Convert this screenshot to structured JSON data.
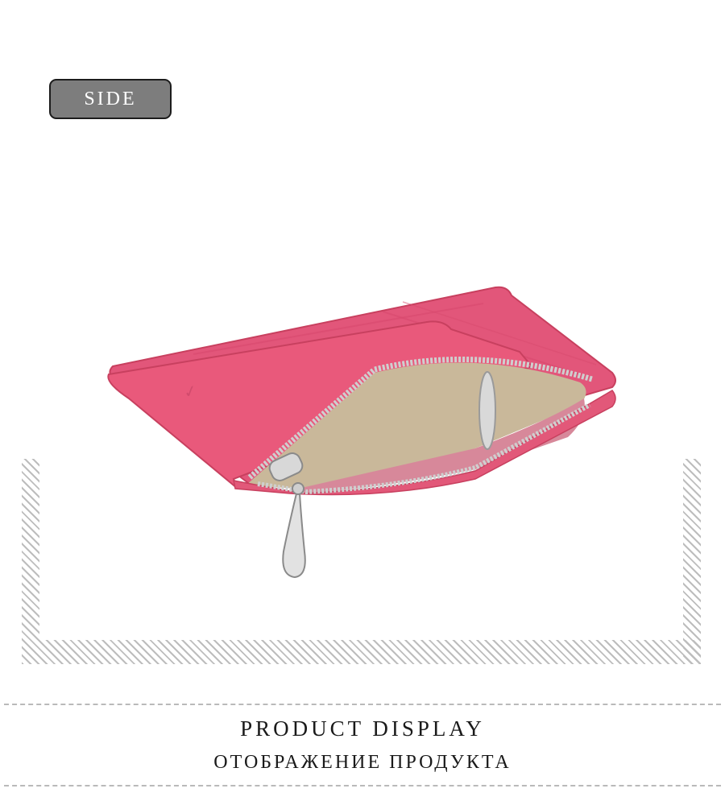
{
  "view_label": "SIDE",
  "section": {
    "title_en": "PRODUCT DISPLAY",
    "title_ru": "ОТОБРАЖЕНИЕ ПРОДУКТА"
  },
  "product_image": {
    "subject": "pink-leather-zip-card-wallet",
    "colors": {
      "leather": "#e9597b",
      "leather_dark": "#c8405f",
      "lining": "#c9b89a",
      "zipper": "#c9c9c9",
      "inner_fabric": "#d7889a"
    }
  },
  "decor": {
    "hatch_color": "#bdbdbd",
    "dash_color": "#b9b9b9"
  }
}
